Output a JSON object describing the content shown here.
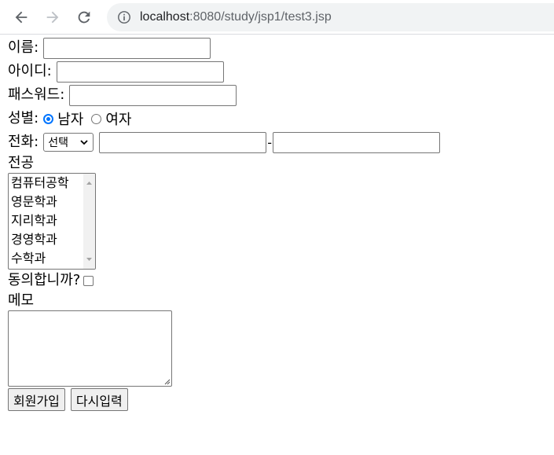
{
  "browser": {
    "url_host": "localhost",
    "url_rest": ":8080/study/jsp1/test3.jsp",
    "icons": [
      "back-arrow-icon",
      "forward-arrow-icon",
      "reload-icon",
      "info-icon"
    ]
  },
  "form": {
    "name_label": "이름:",
    "name_value": "",
    "id_label": "아이디:",
    "id_value": "",
    "password_label": "패스워드:",
    "password_value": "",
    "gender_label": "성별:",
    "gender_options": [
      {
        "label": "남자",
        "checked": true
      },
      {
        "label": "여자",
        "checked": false
      }
    ],
    "phone_label": "전화:",
    "phone_select_value": "선택",
    "phone_separator": "-",
    "phone_part1": "",
    "phone_part2": "",
    "major_label": "전공",
    "major_options": [
      "컴퓨터공학",
      "영문학과",
      "지리학과",
      "경영학과",
      "수학과"
    ],
    "agree_label": "동의합니까?",
    "agree_checked": false,
    "memo_label": "메모",
    "memo_value": "",
    "submit_label": "회원가입",
    "reset_label": "다시입력"
  },
  "colors": {
    "radio_accent": "#0075ff",
    "address_bar_bg": "#f1f3f4",
    "button_bg": "#efefef"
  }
}
